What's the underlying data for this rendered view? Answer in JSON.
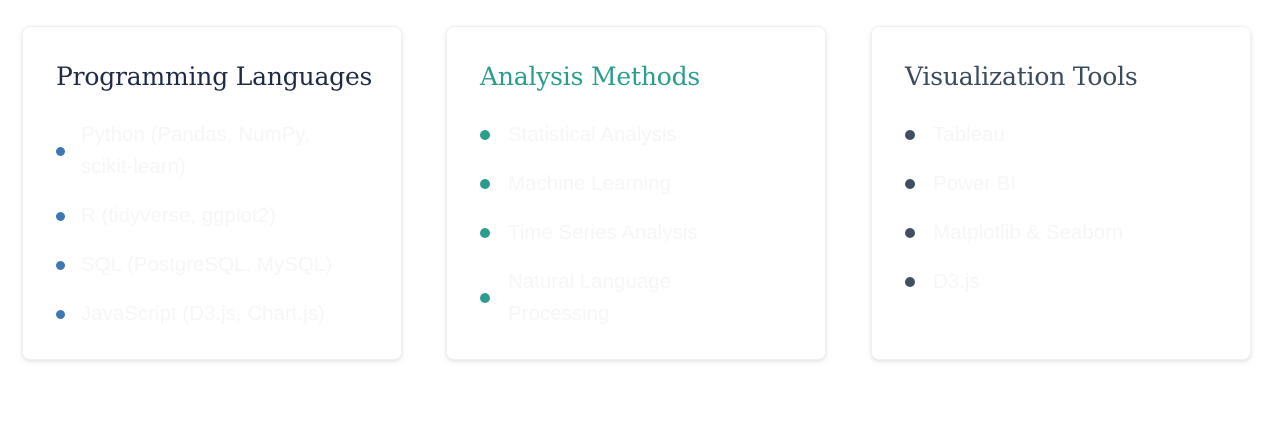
{
  "cards": [
    {
      "title": "Programming Languages",
      "title_color": "#1f2a44",
      "bullet_color": "#3d77b5",
      "items": [
        "Python (Pandas, NumPy, scikit-learn)",
        "R (tidyverse, ggplot2)",
        "SQL (PostgreSQL, MySQL)",
        "JavaScript (D3.js, Chart.js)"
      ]
    },
    {
      "title": "Analysis Methods",
      "title_color": "#2a9d8f",
      "bullet_color": "#2a9d8f",
      "items": [
        "Statistical Analysis",
        "Machine Learning",
        "Time Series Analysis",
        "Natural Language Processing"
      ]
    },
    {
      "title": "Visualization Tools",
      "title_color": "#3a4b5c",
      "bullet_color": "#3d4f61",
      "items": [
        "Tableau",
        "Power BI",
        "Matplotlib & Seaborn",
        "D3.js"
      ]
    }
  ]
}
